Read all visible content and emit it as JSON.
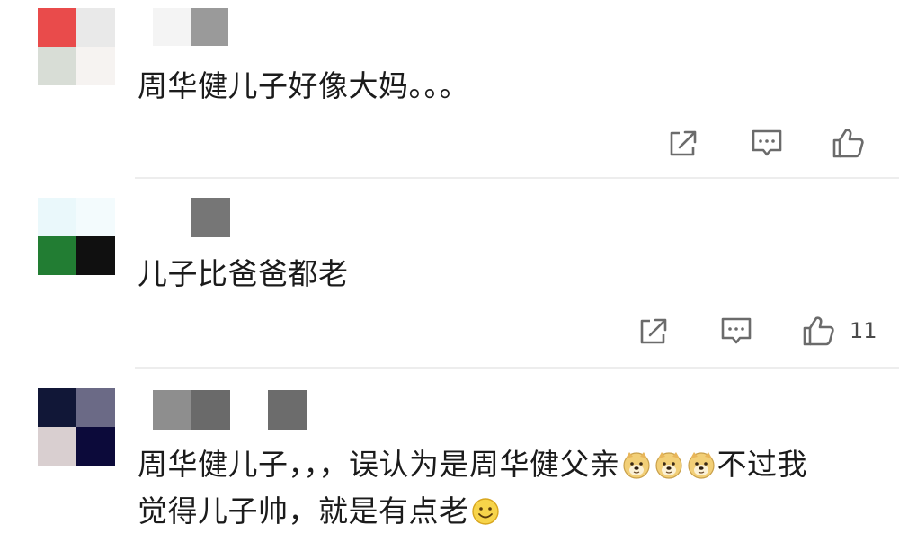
{
  "comments": [
    {
      "text": "周华健儿子好像大妈。。。",
      "avatar_colors": [
        "#e94b4b",
        "#e9e9e9",
        "#d8ddd6",
        "#f6f3f1"
      ],
      "name_blur_colors": [
        "#f4f4f4",
        "#9a9a9a"
      ],
      "like_count": ""
    },
    {
      "text": "儿子比爸爸都老",
      "avatar_colors": [
        "#eaf8fb",
        "#f3fbfd",
        "#227d33",
        "#101010"
      ],
      "name_blur_colors": [
        "#767676"
      ],
      "like_count": "11"
    },
    {
      "text_line1": "周华健儿子，，，误认为是周华健父亲",
      "text_line1_tail": "不过我",
      "text_line2": "觉得儿子帅，就是有点老",
      "avatar_colors": [
        "#111737",
        "#6b6a86",
        "#d9cfd0",
        "#0c0a3a"
      ],
      "name_blur_colors": [
        "#8e8e8e",
        "#6a6a6a",
        "#6c6c6c"
      ],
      "emoji_line1": [
        "doge-emoji",
        "doge-emoji",
        "doge-emoji"
      ],
      "emoji_line2": [
        "smile-emoji"
      ]
    }
  ],
  "icons": {
    "share": "share-icon",
    "reply": "reply-icon",
    "like": "thumbs-up-icon"
  },
  "colors": {
    "icon_stroke": "#6b6b6b",
    "divider": "#ededed",
    "text": "#1b1b1b"
  }
}
